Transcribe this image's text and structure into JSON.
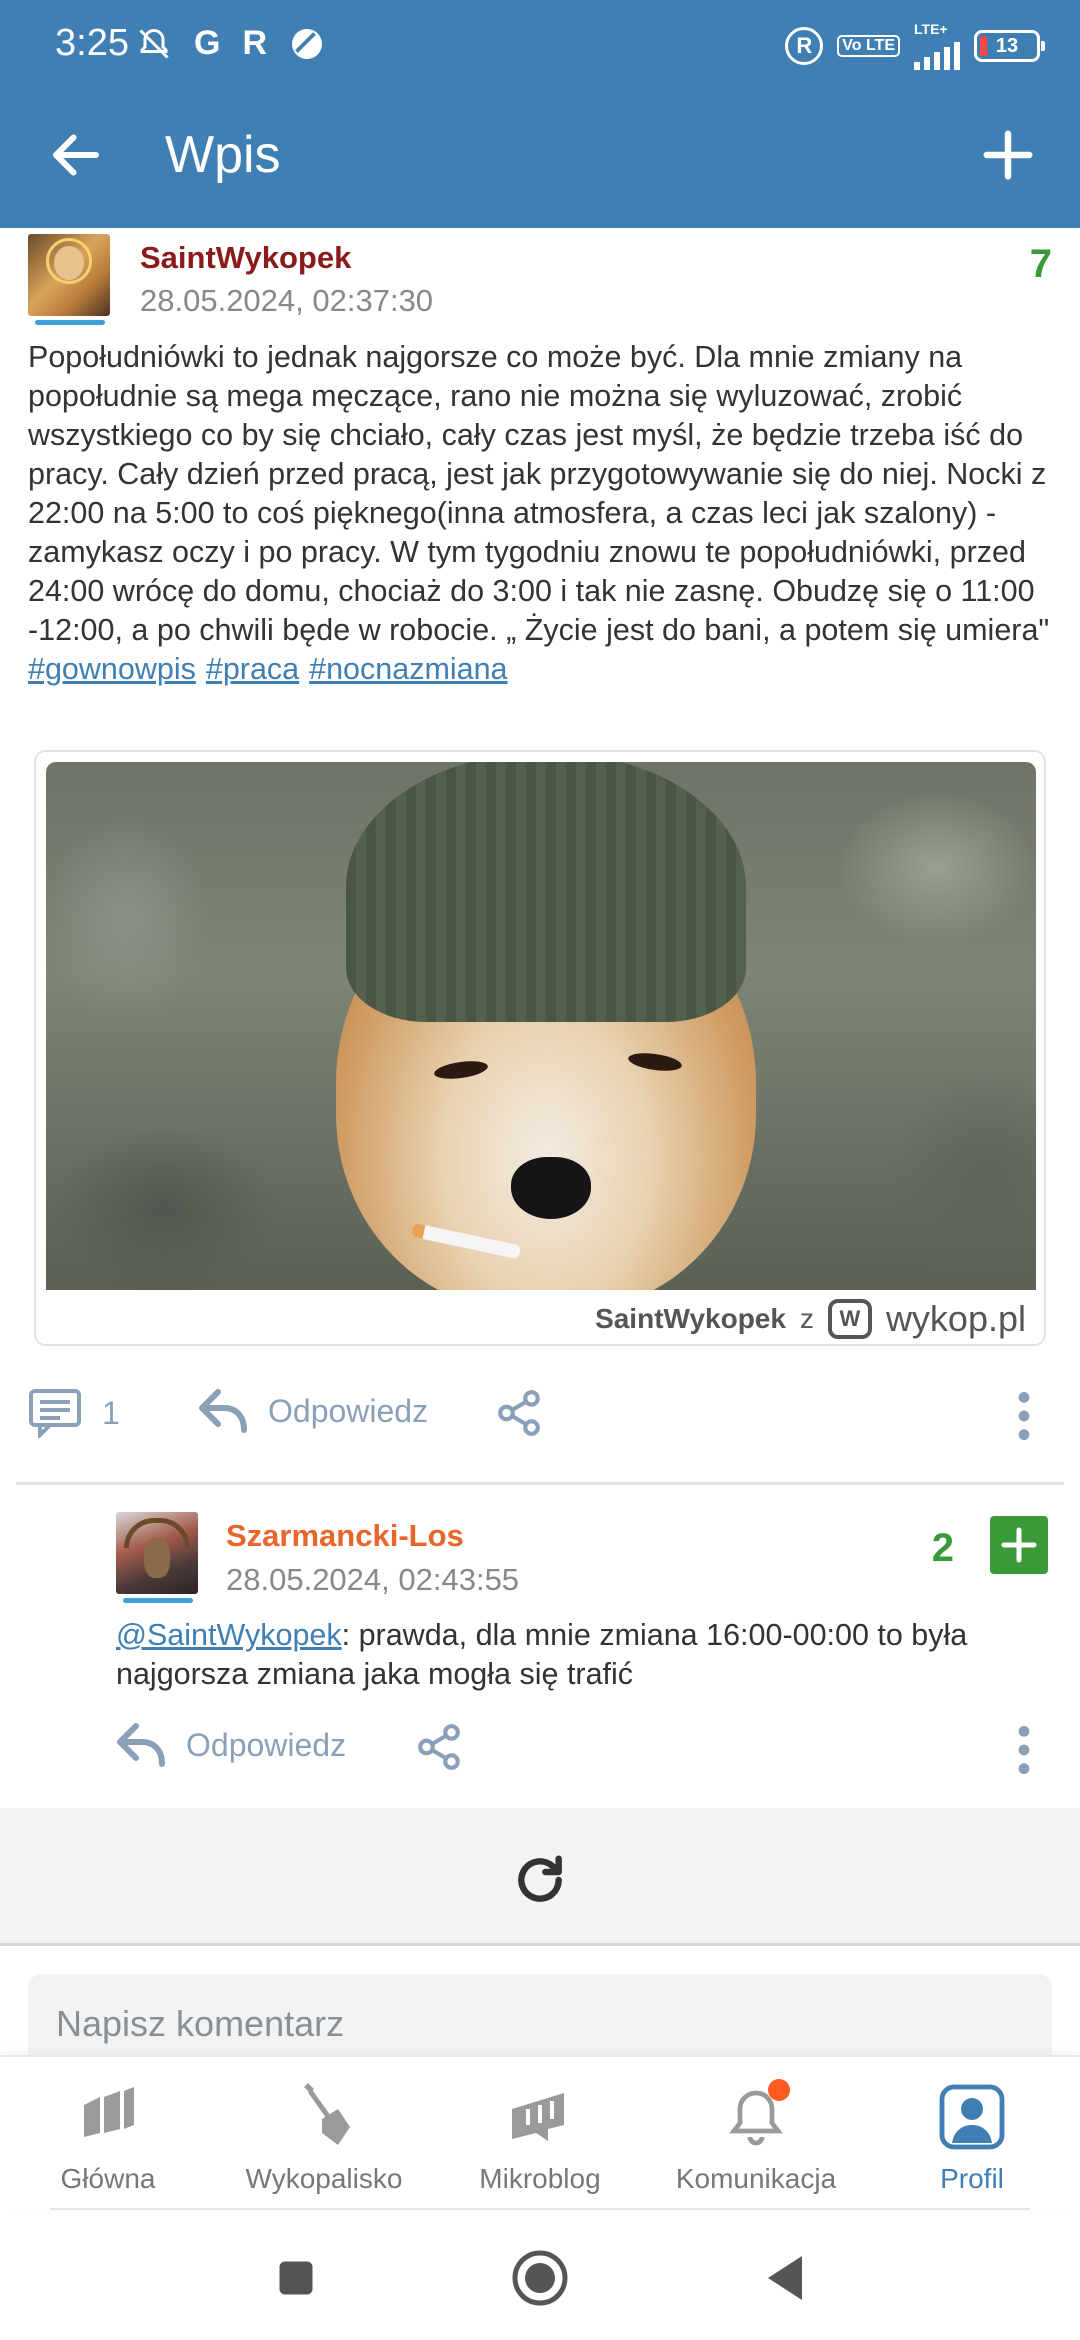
{
  "status_bar": {
    "time": "3:25",
    "left_icons": [
      "bell-off-icon",
      "G",
      "R",
      "no-entry-icon"
    ],
    "battery": "13",
    "network": "LTE+",
    "volte": "Vo LTE"
  },
  "app_bar": {
    "title": "Wpis",
    "back_icon": "arrow-left-icon",
    "add_icon": "plus-icon"
  },
  "post": {
    "author": "SaintWykopek",
    "date": "28.05.2024, 02:37:30",
    "votes": "7",
    "body": "Popołudniówki to jednak najgorsze co może być. Dla mnie zmiany na popołudnie są mega męczące, rano nie można się wyluzować, zrobić wszystkiego co by się chciało, cały czas jest myśl, że będzie trzeba iść do pracy. Cały dzień przed pracą, jest jak przygotowywanie się do niej. Nocki z 22:00 na 5:00 to coś pięknego(inna atmosfera, a czas leci jak szalony) - zamykasz oczy i po pracy. W tym tygodniu znowu te popołudniówki, przed 24:00 wrócę do domu, chociaż do 3:00 i tak nie zasnę. Obudzę się o 11:00 -12:00, a po chwili będe w robocie. „ Życie jest do bani, a potem się umiera\"",
    "tags": [
      "#gownowpis",
      "#praca",
      "#nocnazmiana"
    ],
    "embed": {
      "watermark_user": "SaintWykopek",
      "watermark_z": "z",
      "watermark_site": "wykop.pl"
    },
    "comments_count": "1",
    "reply_label": "Odpowiedz"
  },
  "comment": {
    "author": "Szarmancki-Los",
    "date": "28.05.2024, 02:43:55",
    "votes": "2",
    "mention": "@SaintWykopek",
    "body": ": prawda, dla mnie zmiana 16:00-00:00 to była najgorsza zmiana jaka mogła się trafić",
    "reply_label": "Odpowiedz"
  },
  "comment_input": {
    "placeholder": "Napisz komentarz"
  },
  "bottom_nav": {
    "items": [
      {
        "label": "Główna",
        "icon": "home-icon"
      },
      {
        "label": "Wykopalisko",
        "icon": "shovel-icon"
      },
      {
        "label": "Mikroblog",
        "icon": "mikroblog-icon"
      },
      {
        "label": "Komunikacja",
        "icon": "bell-icon"
      },
      {
        "label": "Profil",
        "icon": "profile-icon"
      }
    ],
    "active": "Profil"
  },
  "colors": {
    "primary": "#3f7fb3",
    "vote_green": "#3a9a3a",
    "author_dark_red": "#8b1a1a",
    "author_orange": "#e8662a",
    "notification": "#ff5a1f"
  }
}
